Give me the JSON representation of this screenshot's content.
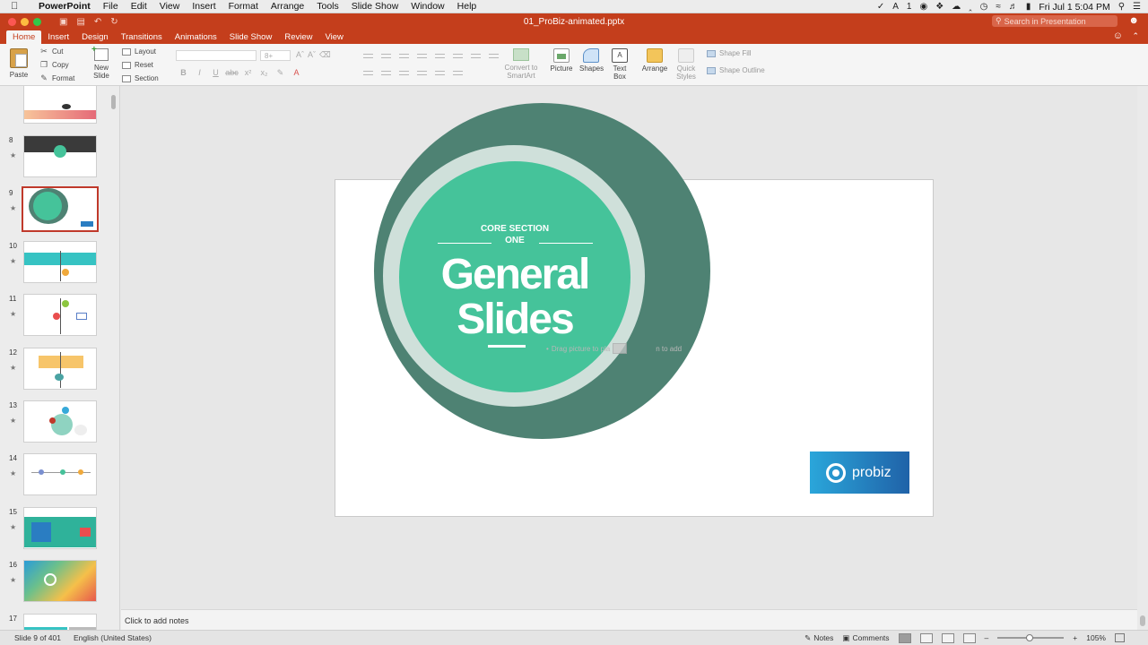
{
  "menubar": {
    "app_name": "PowerPoint",
    "items": [
      "File",
      "Edit",
      "View",
      "Insert",
      "Format",
      "Arrange",
      "Tools",
      "Slide Show",
      "Window",
      "Help"
    ],
    "clock": "Fri Jul 1  5:04 PM",
    "badge": "1"
  },
  "titlebar": {
    "document": "01_ProBiz-animated.pptx",
    "search_placeholder": "Search in Presentation"
  },
  "ribbon_tabs": [
    "Home",
    "Insert",
    "Design",
    "Transitions",
    "Animations",
    "Slide Show",
    "Review",
    "View"
  ],
  "active_tab": "Home",
  "ribbon": {
    "paste": "Paste",
    "cut": "Cut",
    "copy": "Copy",
    "format": "Format",
    "new_slide": "New Slide",
    "layout": "Layout",
    "reset": "Reset",
    "section": "Section",
    "font_size": "8+",
    "convert_smartart": "Convert to SmartArt",
    "picture": "Picture",
    "shapes": "Shapes",
    "text_box": "Text Box",
    "arrange": "Arrange",
    "quick_styles": "Quick Styles",
    "shape_fill": "Shape Fill",
    "shape_outline": "Shape Outline"
  },
  "thumbnails": [
    {
      "num": "",
      "kind": "pink",
      "selected": false
    },
    {
      "num": "8",
      "kind": "dark",
      "selected": false
    },
    {
      "num": "9",
      "kind": "circle",
      "selected": true
    },
    {
      "num": "10",
      "kind": "teal",
      "selected": false
    },
    {
      "num": "11",
      "kind": "nodes",
      "selected": false
    },
    {
      "num": "12",
      "kind": "yellow",
      "selected": false
    },
    {
      "num": "13",
      "kind": "orbit",
      "selected": false
    },
    {
      "num": "14",
      "kind": "timeline",
      "selected": false
    },
    {
      "num": "15",
      "kind": "green",
      "selected": false
    },
    {
      "num": "16",
      "kind": "gradient",
      "selected": false
    },
    {
      "num": "17",
      "kind": "partial",
      "selected": false
    }
  ],
  "slide": {
    "core_section": "CORE SECTION",
    "core_one": "ONE",
    "title_line1": "General",
    "title_line2": "Slides",
    "placeholder_left": "Drag picture to pla",
    "placeholder_right": "n to add",
    "logo_text": "probiz",
    "colors": {
      "outer": "#4e8273",
      "inner": "#45c39a",
      "ring": "#cfe0da",
      "logo": "#2aa6da"
    }
  },
  "notes_placeholder": "Click to add notes",
  "statusbar": {
    "slide_info": "Slide 9 of 401",
    "language": "English (United States)",
    "notes": "Notes",
    "comments": "Comments",
    "zoom": "105%"
  }
}
